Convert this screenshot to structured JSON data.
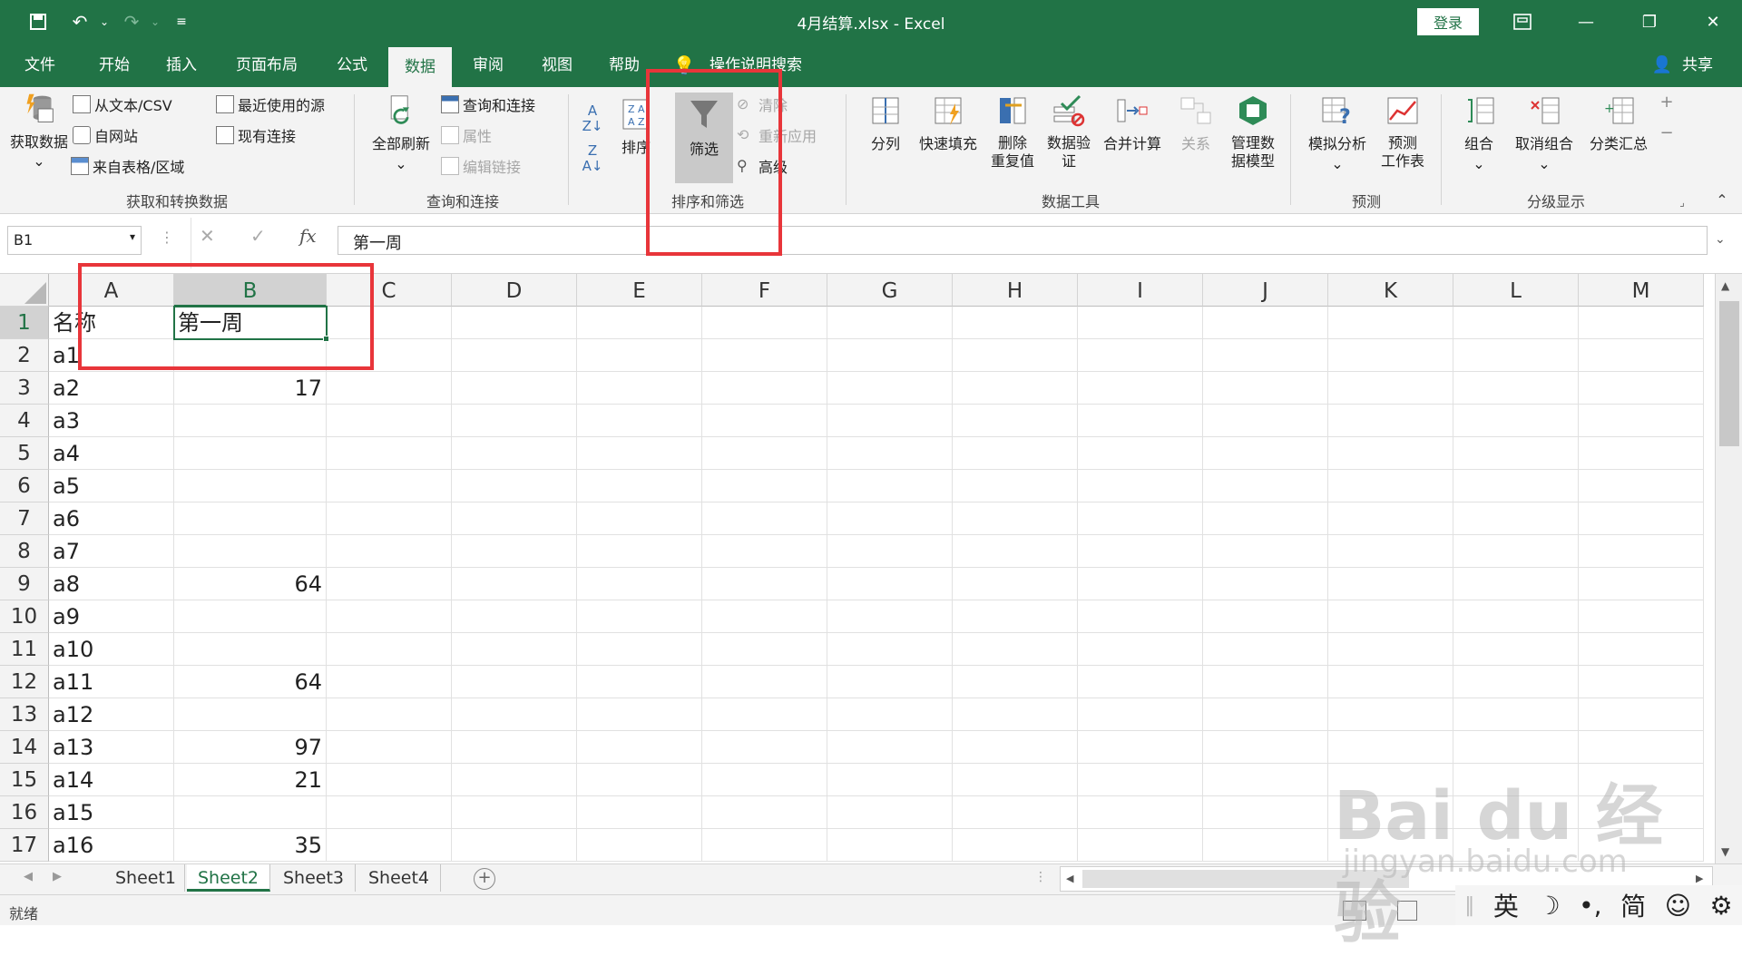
{
  "titlebar": {
    "doc_title": "4月结算.xlsx  -  Excel",
    "login_label": "登录"
  },
  "menu": {
    "tabs": [
      "文件",
      "开始",
      "插入",
      "页面布局",
      "公式",
      "数据",
      "审阅",
      "视图",
      "帮助"
    ],
    "active": "数据",
    "search_hint": "操作说明搜索",
    "share_label": "共享"
  },
  "ribbon": {
    "get_data": {
      "big": "获取数据",
      "items": [
        "从文本/CSV",
        "自网站",
        "来自表格/区域"
      ],
      "items2": [
        "最近使用的源",
        "现有连接"
      ],
      "label": "获取和转换数据"
    },
    "queries": {
      "big": "全部刷新",
      "items": [
        "查询和连接",
        "属性",
        "编辑链接"
      ],
      "label": "查询和连接"
    },
    "sort_filter": {
      "sort": "排序",
      "filter": "筛选",
      "clear": "清除",
      "reapply": "重新应用",
      "advanced": "高级",
      "label": "排序和筛选"
    },
    "data_tools": {
      "buttons": [
        "分列",
        "快速填充",
        "删除\n重复值",
        "数据验\n证",
        "合并计算",
        "关系",
        "管理数\n据模型"
      ],
      "label": "数据工具"
    },
    "forecast": {
      "buttons": [
        "模拟分析",
        "预测\n工作表"
      ],
      "label": "预测"
    },
    "outline": {
      "buttons": [
        "组合",
        "取消组合",
        "分类汇总"
      ],
      "label": "分级显示"
    }
  },
  "formula_bar": {
    "name_box": "B1",
    "fx": "fx",
    "value": "第一周"
  },
  "sheet": {
    "columns": [
      "A",
      "B",
      "C",
      "D",
      "E",
      "F",
      "G",
      "H",
      "I",
      "J",
      "K",
      "L",
      "M"
    ],
    "selected_col": "B",
    "selected_row": 1,
    "rows": [
      {
        "n": "1",
        "a": "名称",
        "b": "第一周"
      },
      {
        "n": "2",
        "a": "a1",
        "b": ""
      },
      {
        "n": "3",
        "a": "a2",
        "b": "17"
      },
      {
        "n": "4",
        "a": "a3",
        "b": ""
      },
      {
        "n": "5",
        "a": "a4",
        "b": ""
      },
      {
        "n": "6",
        "a": "a5",
        "b": ""
      },
      {
        "n": "7",
        "a": "a6",
        "b": ""
      },
      {
        "n": "8",
        "a": "a7",
        "b": ""
      },
      {
        "n": "9",
        "a": "a8",
        "b": "64"
      },
      {
        "n": "10",
        "a": "a9",
        "b": ""
      },
      {
        "n": "11",
        "a": "a10",
        "b": ""
      },
      {
        "n": "12",
        "a": "a11",
        "b": "64"
      },
      {
        "n": "13",
        "a": "a12",
        "b": ""
      },
      {
        "n": "14",
        "a": "a13",
        "b": "97"
      },
      {
        "n": "15",
        "a": "a14",
        "b": "21"
      },
      {
        "n": "16",
        "a": "a15",
        "b": ""
      },
      {
        "n": "17",
        "a": "a16",
        "b": "35"
      }
    ]
  },
  "sheet_tabs": [
    "Sheet1",
    "Sheet2",
    "Sheet3",
    "Sheet4"
  ],
  "active_sheet": "Sheet2",
  "status": {
    "ready": "就绪"
  },
  "ime": [
    "英",
    "简"
  ],
  "watermark": {
    "brand": "Bai du 经验",
    "url": "jingyan.baidu.com"
  }
}
